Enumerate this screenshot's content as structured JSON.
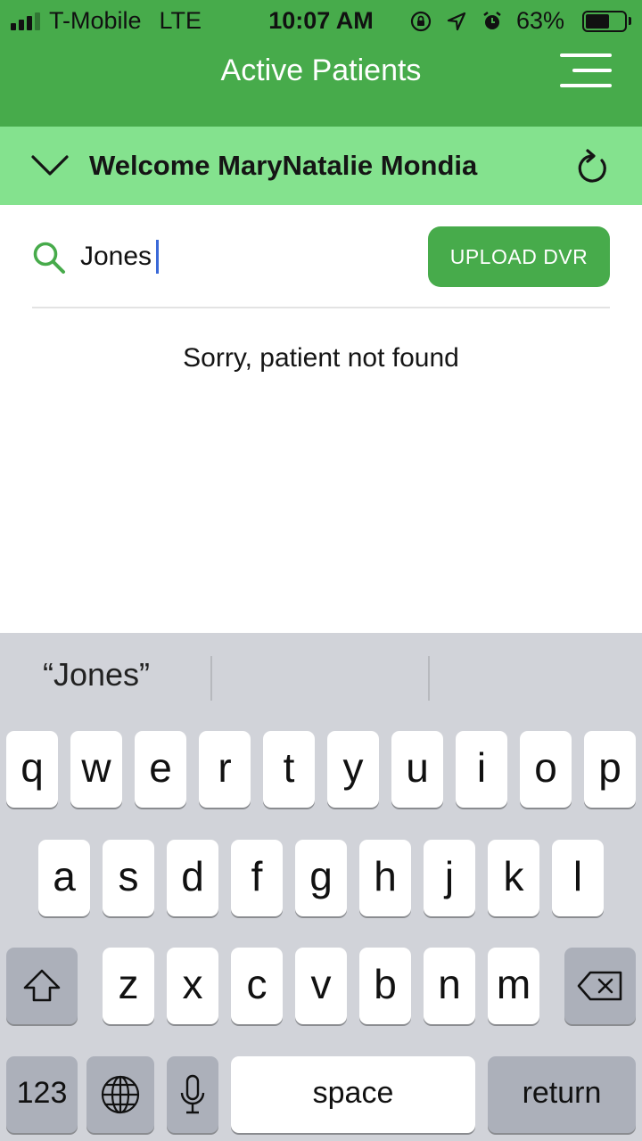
{
  "status_bar": {
    "carrier": "T-Mobile",
    "network": "LTE",
    "time": "10:07 AM",
    "battery": "63%",
    "battery_level": 0.63,
    "icons": [
      "signal-icon",
      "orientation-lock-icon",
      "location-icon",
      "alarm-icon",
      "battery-icon"
    ]
  },
  "header": {
    "title": "Active Patients",
    "menu_icon": "hamburger-menu-icon"
  },
  "welcome": {
    "text": "Welcome MaryNatalie Mondia",
    "expand_icon": "chevron-down-icon",
    "refresh_icon": "refresh-icon"
  },
  "search": {
    "value": "Jones",
    "placeholder": "",
    "icon": "search-icon"
  },
  "upload_button": {
    "label": "UPLOAD DVR"
  },
  "message": "Sorry, patient not found",
  "keyboard": {
    "suggestion": "“Jones”",
    "row1": [
      "q",
      "w",
      "e",
      "r",
      "t",
      "y",
      "u",
      "i",
      "o",
      "p"
    ],
    "row2": [
      "a",
      "s",
      "d",
      "f",
      "g",
      "h",
      "j",
      "k",
      "l"
    ],
    "row3": [
      "z",
      "x",
      "c",
      "v",
      "b",
      "n",
      "m"
    ],
    "numbers_label": "123",
    "space_label": "space",
    "return_label": "return",
    "special_icons": [
      "shift-icon",
      "backspace-icon",
      "globe-icon",
      "microphone-icon"
    ]
  },
  "colors": {
    "primary_green": "#47ab4b",
    "light_green": "#84e28e",
    "keyboard_bg": "#d1d3d9"
  }
}
